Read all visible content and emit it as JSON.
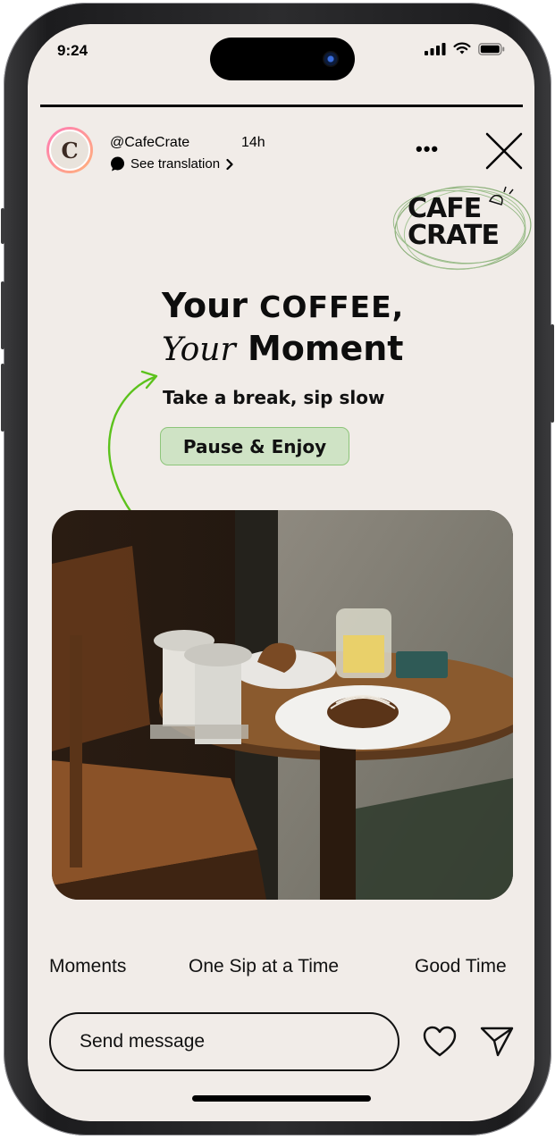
{
  "status_bar": {
    "time": "9:24"
  },
  "story": {
    "progress": 1.0,
    "author": {
      "handle": "@CafeCrate",
      "time_ago": "14h",
      "avatar_letter": "C"
    },
    "translation_label": "See translation"
  },
  "brand": {
    "logo_line1": "CAFE",
    "logo_line2": "CRATE"
  },
  "content": {
    "headline_part1": "Your ",
    "headline_caps": "COFFEE,",
    "headline_script": "Your",
    "headline_end": " Moment",
    "subheadline": "Take a break, sip slow",
    "cta_label": "Pause & Enjoy"
  },
  "hashtags": [
    "Moments",
    "One Sip at a Time",
    "Good Time"
  ],
  "composer": {
    "placeholder": "Send message"
  },
  "colors": {
    "background": "#f1ece8",
    "cta_fill": "#cfe3c5",
    "arrow": "#5cc21c"
  }
}
